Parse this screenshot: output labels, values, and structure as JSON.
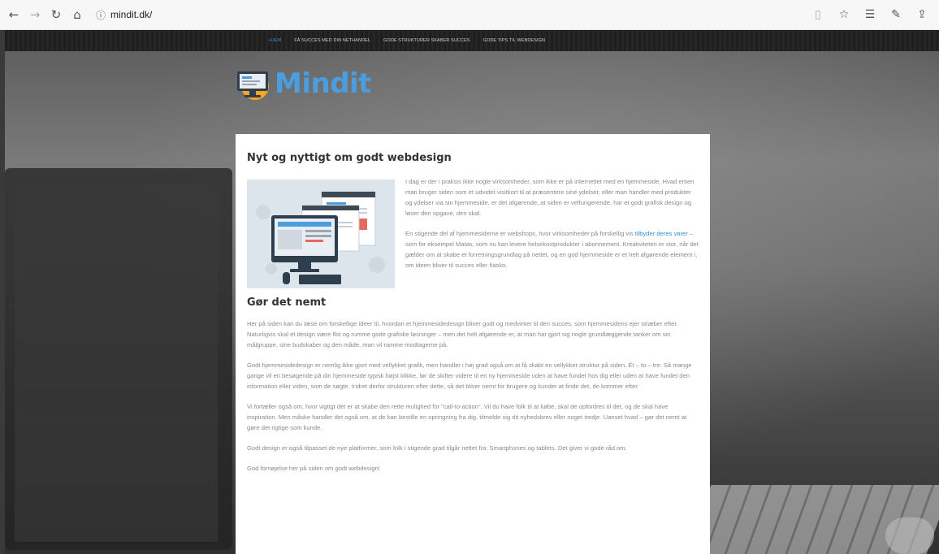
{
  "browser": {
    "url": "mindit.dk/",
    "icons": [
      "back-arrow-icon",
      "forward-arrow-icon",
      "refresh-icon",
      "home-icon",
      "site-info-icon",
      "reader-view-icon",
      "favorite-star-icon",
      "favorites-list-icon",
      "pen-icon",
      "share-icon"
    ]
  },
  "site_nav": {
    "items": [
      {
        "label": "HJEM"
      },
      {
        "label": "FÅ SUCCES MED DIN NETHANDEL"
      },
      {
        "label": "GODE STRUKTURER SKABER SUCCES"
      },
      {
        "label": "GODE TIPS TIL WEBDESIGN"
      }
    ]
  },
  "logo": {
    "text": "Mindit"
  },
  "article": {
    "title": "Nyt og nyttigt om godt webdesign",
    "intro_p1": "I dag er der i praksis ikke nogle virksomheder, som ikke er på internettet med en hjemmeside. Hvad enten man bruger siden som et udvidet visitkort til at præsentere sine ydelser, eller man handler med produkter og ydelser via sin hjemmeside, er det afgørende, at siden er velfungerende, har et godt grafisk design og løser den opgave, den skal.",
    "intro_p2_before": "En stigende del af hjemmesiderne er webshops, hvor virksomheder på forskellig vis ",
    "intro_p2_link": "tilbyder deres varer",
    "intro_p2_after": " – som for eksempel Matas, som nu kan levere helsekostprodukter i abonnement. Kreativiteten er stor, når det gælder om at skabe et forretningsgrundlag på nettet, og en god hjemmeside er et helt afgørende element i, om ideen bliver til succes eller fiasko.",
    "section_title": "Gør det nemt",
    "p1": "Her på siden kan du læse om forskellige ideer til, hvordan et hjemmesidedesign bliver godt og medvirker til den succes, som hjemmesidens ejer stræber efter. Naturligvis skal et design være flot og rumme gode grafiske løsninger – men det helt afgørende er, at man har gjort sig nogle grundlæggende tanker om sin målgruppe, sine budskaber og den måde, man vil ramme modtagerne på.",
    "p2": "Godt hjemmesidedesign er nemlig ikke gjort med vellykket grafik, men handler i høj grad også om at få skabt en vellykket struktur på siden. Ét – to – tre: Så mange gange vil en besøgende på din hjemmeside typisk højst klikke, før de skifter videre til en ny hjemmeside uden at have fundet hos dig eller uden at have fundet den information eller viden, som de søgte. Indret derfor strukturen efter dette, så det bliver nemt for brugere og kunder at finde det, de kommer efter.",
    "p3": "Vi fortæller også om, hvor vigtigt det er at skabe den rette mulighed for \"call-to-action\". Vil du have folk til at købe, skal de opfordres til det, og de skal have inspiration. Men måske handler det også om, at de kan bestille en opringning fra dig, tilmelde sig dit nyhedsbrev eller noget tredje. Uanset hvad – gør det nemt at gøre det rigtige som kunde.",
    "p4": "Godt design er også tilpasset de nye platformer, som folk i stigende grad tilgår nettet fra: Smartphones og tablets. Det giver vi gode råd om.",
    "p5": "God fornøjelse her på siden om godt webdesign!"
  },
  "colors": {
    "accent": "#2d8fe0",
    "logo": "#4a9ee0",
    "body_text": "#8a8a8a",
    "heading": "#333333"
  }
}
